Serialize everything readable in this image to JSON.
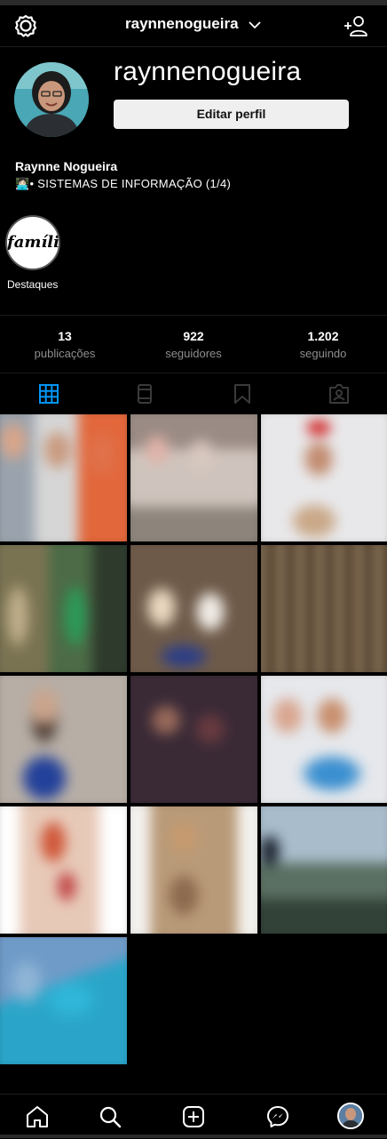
{
  "header": {
    "username": "raynnenogueira"
  },
  "profile": {
    "display_username": "raynnenogueira",
    "edit_button": "Editar perfil",
    "full_name": "Raynne Nogueira",
    "bio": "👩🏻‍💻• SISTEMAS DE INFORMAÇÃO (1/4)"
  },
  "highlights": [
    {
      "cover_text": "família",
      "label": "Destaques"
    }
  ],
  "stats": {
    "posts_count": "13",
    "posts_label": "publicações",
    "followers_count": "922",
    "followers_label": "seguidores",
    "following_count": "1.202",
    "following_label": "seguindo"
  },
  "tabs": [
    {
      "icon": "grid-icon",
      "active": true
    },
    {
      "icon": "reels-icon",
      "active": false
    },
    {
      "icon": "saved-icon",
      "active": false
    },
    {
      "icon": "tagged-icon",
      "active": false
    }
  ],
  "posts_count_visible": 13,
  "bottom_nav": [
    "home-icon",
    "search-icon",
    "new-post-icon",
    "messenger-icon",
    "profile-avatar"
  ],
  "colors": {
    "accent": "#0095f6",
    "background": "#000000",
    "muted": "#8e8e8e"
  }
}
